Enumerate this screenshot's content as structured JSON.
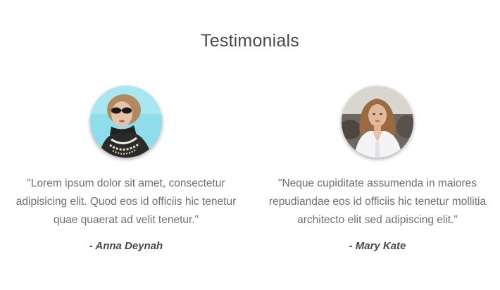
{
  "section": {
    "title": "Testimonials"
  },
  "testimonials": [
    {
      "quote": "\"Lorem ipsum dolor sit amet, consectetur adipisicing elit. Quod eos id officiis hic tenetur quae quaerat ad velit tenetur.\"",
      "author": "- Anna Deynah",
      "avatar": "anna-deynah-avatar"
    },
    {
      "quote": "\"Neque cupiditate assumenda in maiores repudiandae eos id officiis hic tenetur mollitia architecto elit sed adipiscing elit.\"",
      "author": "- Mary Kate",
      "avatar": "mary-kate-avatar"
    }
  ],
  "colors": {
    "title": "#4a4a4a",
    "text": "#6f6f6f",
    "author": "#4a4a4a",
    "background": "#ffffff"
  }
}
